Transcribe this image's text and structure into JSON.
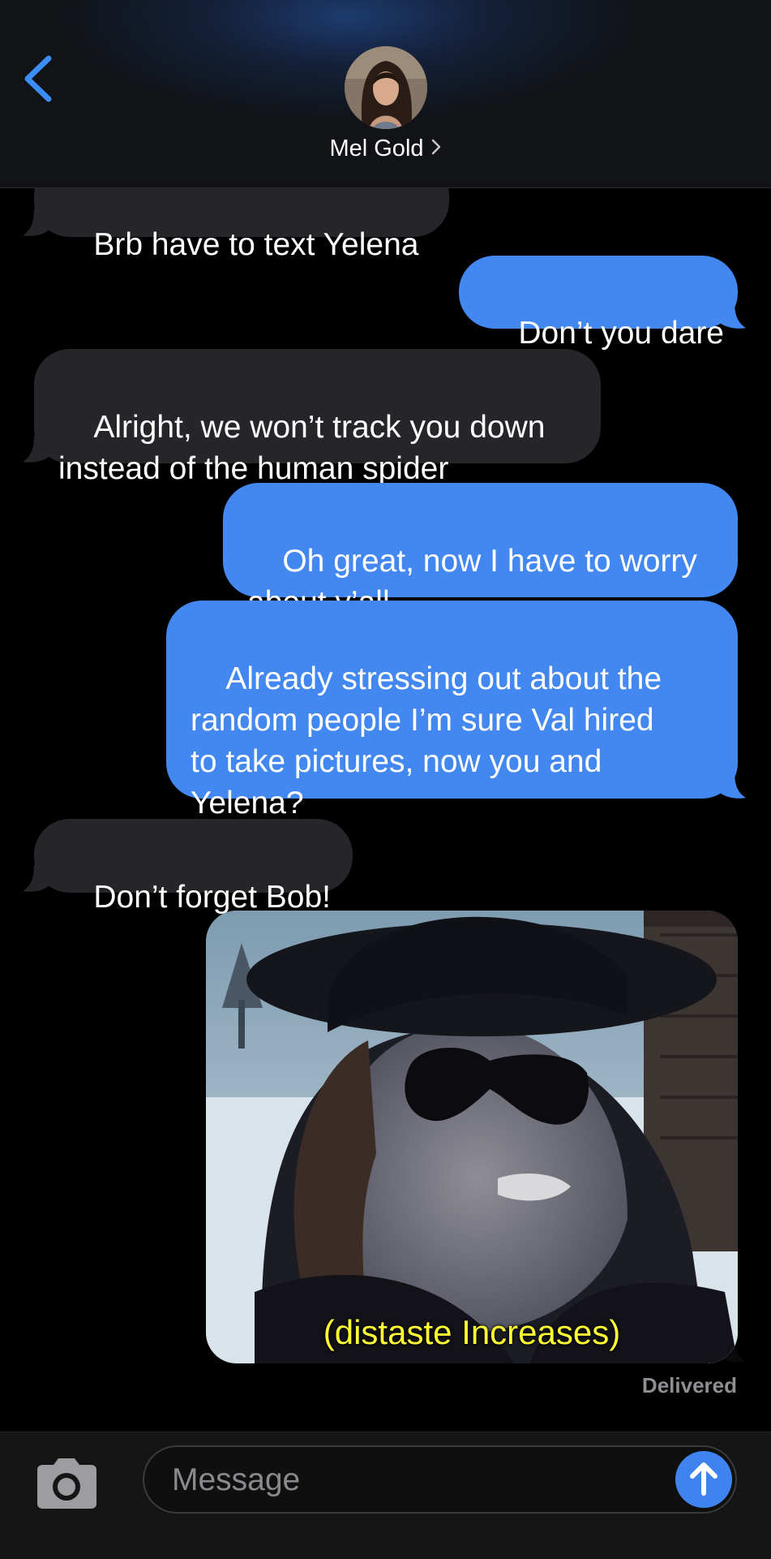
{
  "header": {
    "contact_name": "Mel Gold"
  },
  "messages": [
    {
      "direction": "in",
      "text": "Brb have to text Yelena"
    },
    {
      "direction": "out",
      "text": "Don’t you dare"
    },
    {
      "direction": "in",
      "text": "Alright, we won’t track you down\ninstead of the human spider"
    },
    {
      "direction": "out",
      "text": "Oh great, now I have to worry\nabout y’all"
    },
    {
      "direction": "out",
      "text": "Already stressing out about the\nrandom people I’m sure Val hired\nto take pictures, now you and\nYelena?"
    },
    {
      "direction": "in",
      "text": "Don’t forget Bob!"
    },
    {
      "direction": "out",
      "type": "image",
      "caption": "(distaste Increases)"
    }
  ],
  "status": {
    "delivered": "Delivered"
  },
  "composer": {
    "placeholder": "Message"
  },
  "colors": {
    "outgoing_bubble": "#4288f0",
    "incoming_bubble": "#26252a",
    "accent": "#3f84ee",
    "caption": "#ffff33"
  },
  "icons": [
    "back-chevron-icon",
    "chevron-right-icon",
    "camera-icon",
    "arrow-up-icon"
  ]
}
